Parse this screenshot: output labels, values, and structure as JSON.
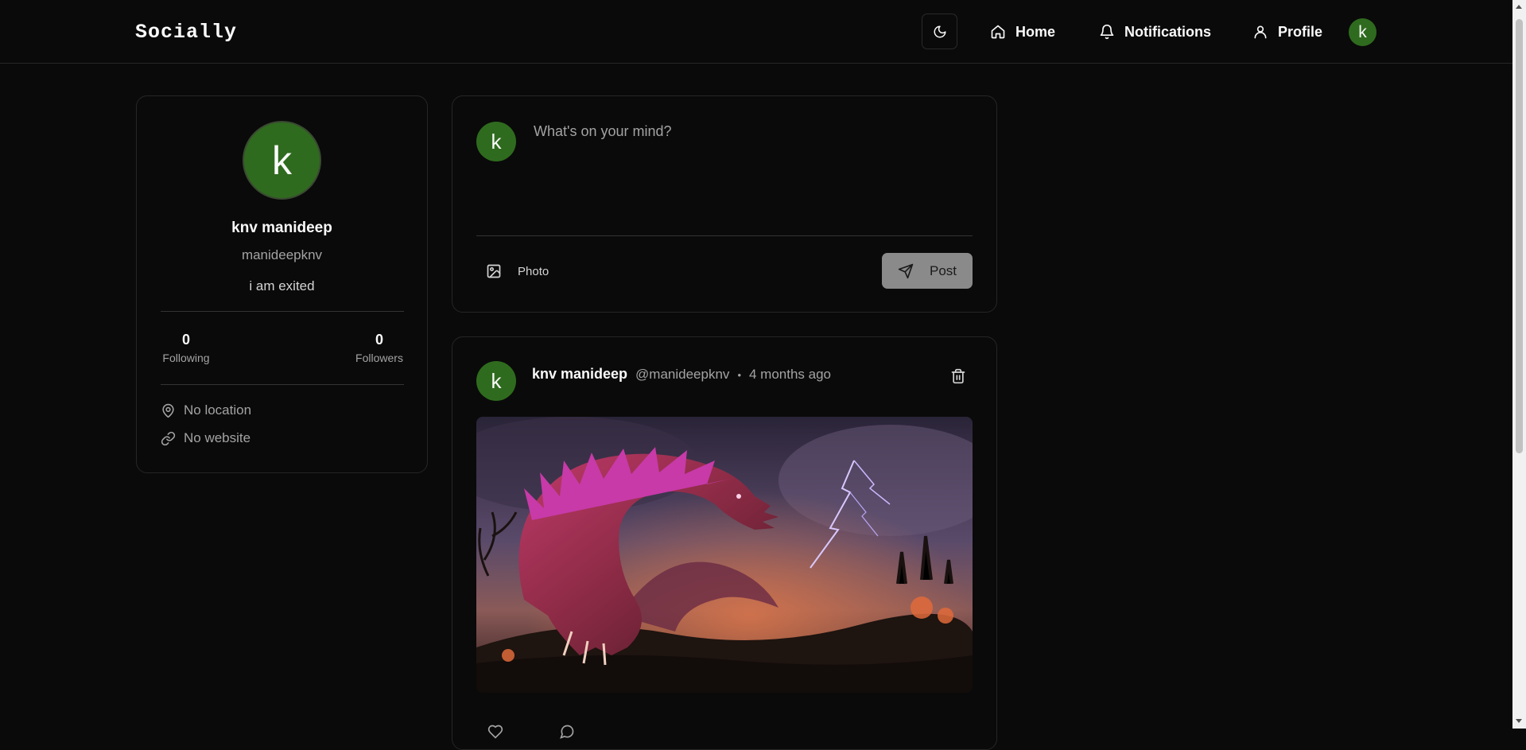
{
  "header": {
    "brand": "Socially",
    "nav": {
      "home": "Home",
      "notifications": "Notifications",
      "profile": "Profile"
    },
    "avatar_initial": "k",
    "theme_icon": "moon-icon"
  },
  "profile_card": {
    "avatar_initial": "k",
    "name": "knv manideep",
    "username": "manideepknv",
    "bio": "i am exited",
    "following_count": "0",
    "following_label": "Following",
    "followers_count": "0",
    "followers_label": "Followers",
    "location": "No location",
    "website": "No website"
  },
  "composer": {
    "avatar_initial": "k",
    "placeholder": "What's on your mind?",
    "photo_label": "Photo",
    "post_label": "Post"
  },
  "post": {
    "avatar_initial": "k",
    "author": "knv manideep",
    "handle": "@manideepknv",
    "separator": "•",
    "time": "4 months ago",
    "image_alt": "Dragon breathing lightning over a burning landscape"
  },
  "colors": {
    "background": "#0a0a0a",
    "border": "#262626",
    "avatar_green": "#2f6b1e",
    "muted_text": "#a3a3a3",
    "post_button": "#8a8a8a"
  }
}
